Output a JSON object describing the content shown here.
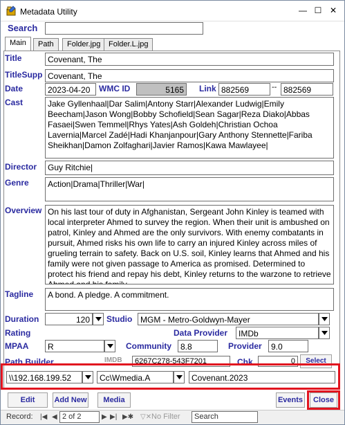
{
  "window": {
    "title": "Metadata Utility"
  },
  "search": {
    "label": "Search",
    "value": ""
  },
  "tabs": [
    {
      "label": "Main"
    },
    {
      "label": "Path"
    },
    {
      "label": "Folder.jpg"
    },
    {
      "label": "Folder.L.jpg"
    }
  ],
  "fields": {
    "title_label": "Title",
    "title": "Covenant, The",
    "titlesupp_label": "TitleSupp",
    "titlesupp": "Covenant, The",
    "date_label": "Date",
    "date": "2023-04-20",
    "wmcid_label": "WMC ID",
    "wmcid": "5165",
    "link_label": "Link",
    "link1": "882569",
    "link_sep": "--",
    "link2": "882569",
    "cast_label": "Cast",
    "cast": "Jake Gyllenhaal|Dar Salim|Antony Starr|Alexander Ludwig|Emily Beecham|Jason Wong|Bobby Schofield|Sean Sagar|Reza Diako|Abbas Fasaei|Swen Temmel|Rhys Yates|Ash Goldeh|Christian Ochoa Lavernia|Marcel Zadé|Hadi Khanjanpour|Gary Anthony Stennette|Fariba Sheikhan|Damon Zolfaghari|Javier Ramos|Kawa Mawlayee|",
    "director_label": "Director",
    "director": "Guy Ritchie|",
    "genre_label": "Genre",
    "genre": "Action|Drama|Thriller|War|",
    "overview_label": "Overview",
    "overview": "On his last tour of duty in Afghanistan, Sergeant John Kinley is teamed with local interpreter Ahmed to survey the region. When their unit is ambushed on patrol, Kinley and Ahmed are the only survivors. With enemy combatants in pursuit, Ahmed risks his own life to carry an injured Kinley across miles of grueling terrain to safety. Back on U.S. soil, Kinley learns that Ahmed and his family were not given passage to America as promised. Determined to protect his friend and repay his debt, Kinley returns to the warzone to retrieve Ahmed and his family",
    "tagline_label": "Tagline",
    "tagline": "A bond. A pledge. A commitment.",
    "duration_label": "Duration",
    "duration": "120",
    "studio_label": "Studio",
    "studio": "MGM - Metro-Goldwyn-Mayer",
    "rating_label": "Rating",
    "data_provider_label": "Data Provider",
    "data_provider": "IMDb",
    "mpaa_label": "MPAA",
    "mpaa": "R",
    "community_label": "Community",
    "community": "8.8",
    "provider_label": "Provider",
    "provider": "9.0",
    "path_builder_label": "Path Builder",
    "imdb_label": "IMDB",
    "imdb_value": "6267C278-543F7201",
    "chk_label": "Chk",
    "chk_value": "0",
    "select_label": "Select",
    "server": "\\\\192.168.199.52",
    "share": "Cc\\Wmedia.A",
    "folder": "Covenant.2023"
  },
  "buttons": {
    "edit_record": "Edit Record",
    "add_new": "Add New",
    "media": "Media",
    "events": "Events",
    "close": "Close"
  },
  "statusbar": {
    "record_label": "Record:",
    "record_value": "2 of 2",
    "no_filter": "No Filter",
    "search": "Search"
  },
  "colors": {
    "label": "#2a2aa0",
    "highlight": "#e1141f",
    "wmc_bg": "#c0c0c0"
  }
}
